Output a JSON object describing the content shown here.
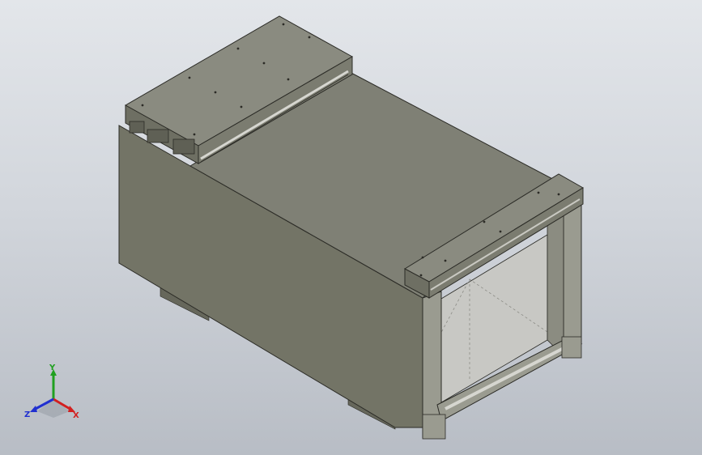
{
  "viewport": {
    "background_top": "#e3e6ea",
    "background_bottom": "#b8bdc5"
  },
  "model": {
    "name": "duct-section",
    "colors": {
      "side_face": "#737466",
      "top_face": "#7f8075",
      "plate_top": "#8a8b80",
      "plate_side": "#6e6f63",
      "frame": "#9a9b90",
      "frame_dark": "#5f6055",
      "interior": "#c8c8c4",
      "edge": "#2b2b26",
      "rail": "#d6d6d0"
    }
  },
  "triad": {
    "x_label": "X",
    "y_label": "Y",
    "z_label": "Z",
    "x_color": "#d22020",
    "y_color": "#20a020",
    "z_color": "#2030d0"
  }
}
